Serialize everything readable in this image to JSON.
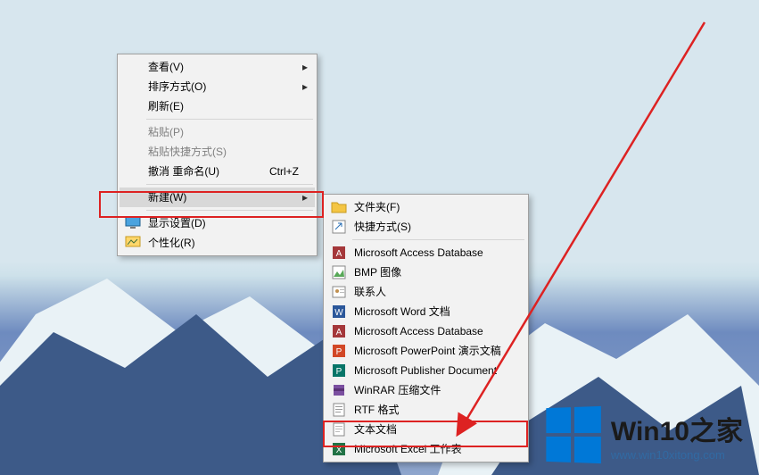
{
  "menu1": {
    "view": {
      "label": "查看(V)"
    },
    "sort": {
      "label": "排序方式(O)"
    },
    "refresh": {
      "label": "刷新(E)"
    },
    "paste": {
      "label": "粘贴(P)"
    },
    "paste_short": {
      "label": "粘贴快捷方式(S)"
    },
    "undo": {
      "label": "撤消 重命名(U)",
      "shortcut": "Ctrl+Z"
    },
    "new": {
      "label": "新建(W)"
    },
    "display": {
      "label": "显示设置(D)"
    },
    "personalize": {
      "label": "个性化(R)"
    }
  },
  "menu2": {
    "folder": {
      "label": "文件夹(F)"
    },
    "shortcut": {
      "label": "快捷方式(S)"
    },
    "access1": {
      "label": "Microsoft Access Database"
    },
    "bmp": {
      "label": "BMP 图像"
    },
    "contact": {
      "label": "联系人"
    },
    "word": {
      "label": "Microsoft Word 文档"
    },
    "access2": {
      "label": "Microsoft Access Database"
    },
    "ppt": {
      "label": "Microsoft PowerPoint 演示文稿"
    },
    "publisher": {
      "label": "Microsoft Publisher Document"
    },
    "winrar": {
      "label": "WinRAR 压缩文件"
    },
    "rtf": {
      "label": "RTF 格式"
    },
    "txt": {
      "label": "文本文档"
    },
    "excel": {
      "label": "Microsoft Excel 工作表"
    }
  },
  "brand": {
    "title": "Win10之家",
    "url": "www.win10xitong.com"
  }
}
